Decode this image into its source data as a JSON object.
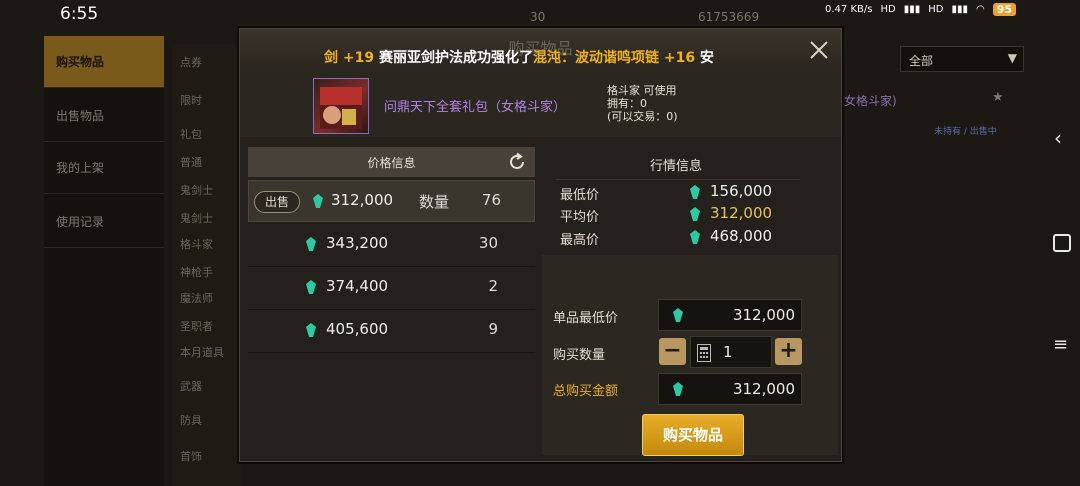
{
  "status_bar": {
    "time": "6:55",
    "net_speed": "0.47 KB/s",
    "signal_1": "HD",
    "signal_2": "HD",
    "battery": "95"
  },
  "background": {
    "top_currency_1": "30",
    "top_currency_2": "61753669",
    "nav": [
      "购买物品",
      "出售物品",
      "我的上架",
      "使用记录"
    ],
    "nav_active": 0,
    "categories": [
      "点券",
      "限时",
      "礼包",
      "普通",
      "鬼剑士",
      "鬼剑士",
      "格斗家",
      "神枪手",
      "魔法师",
      "圣职者",
      "本月道具",
      "武器",
      "防具",
      "首饰"
    ],
    "filter_label": "全部",
    "right_item_text": "女格斗家)",
    "right_status": "未持有 / 出售中"
  },
  "dialog": {
    "title": "购买物品",
    "ticker": [
      {
        "text": "剑 +19",
        "color": "yellow"
      },
      {
        "text": "  赛丽亚剑护法成功强化了",
        "color": "white"
      },
      {
        "text": "混沌：波动谐鸣项链 +16",
        "color": "yellow"
      },
      {
        "text": "       安",
        "color": "white"
      }
    ],
    "item": {
      "name": "问鼎天下全套礼包（女格斗家）",
      "usable": "格斗家 可使用",
      "owned": "拥有：0",
      "tradeable": "(可以交易：0)"
    },
    "price_panel": {
      "header": "价格信息",
      "sell_label": "出售",
      "qty_label": "数量",
      "rows": [
        {
          "price": "312,000",
          "qty": "76"
        },
        {
          "price": "343,200",
          "qty": "30"
        },
        {
          "price": "374,400",
          "qty": "2"
        },
        {
          "price": "405,600",
          "qty": "9"
        }
      ]
    },
    "market_panel": {
      "header": "行情信息",
      "min_label": "最低价",
      "min_value": "156,000",
      "avg_label": "平均价",
      "avg_value": "312,000",
      "max_label": "最高价",
      "max_value": "468,000"
    },
    "purchase": {
      "unit_min_label": "单品最低价",
      "unit_min_value": "312,000",
      "qty_label": "购买数量",
      "qty_value": "1",
      "total_label": "总购买金额",
      "total_value": "312,000",
      "buy_button": "购买物品"
    }
  },
  "colors": {
    "accent": "#e9ad2a",
    "gem": "#2ec9a0",
    "purple_name": "#b383e0"
  }
}
